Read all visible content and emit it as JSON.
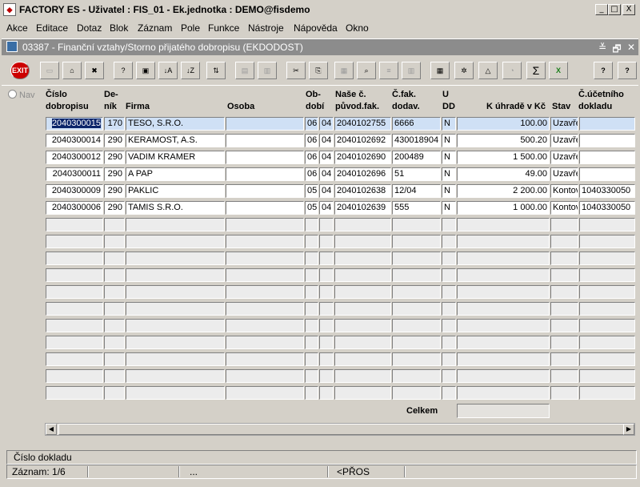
{
  "window": {
    "title": "FACTORY ES - Uživatel : FIS_01 - Ek.jednotka : DEMO@fisdemo",
    "controls": [
      "_",
      "□",
      "X"
    ]
  },
  "menu": [
    "Akce",
    "Editace",
    "Dotaz",
    "Blok",
    "Záznam",
    "Pole",
    "Funkce",
    "Nástroje",
    "Nápověda",
    "Okno"
  ],
  "form": {
    "title": "03387 - Finanční vztahy/Storno přijatého dobropisu (EKDODOST)",
    "controls": [
      "≚",
      "🗗",
      "✕"
    ]
  },
  "toolbar": {
    "exit_label": "EXIT",
    "sigma_label": "Σ",
    "help_label": "?",
    "help2_label": "?"
  },
  "nav_label": "Nav",
  "columns": {
    "cislo": [
      "Číslo",
      "dobropisu"
    ],
    "denik": [
      "De-",
      "ník"
    ],
    "firma": "Firma",
    "osoba": "Osoba",
    "obdobi": [
      "Ob-",
      "dobí"
    ],
    "nase": [
      "Naše č.",
      "původ.fak."
    ],
    "cfak": [
      "Č.fak.",
      "dodav."
    ],
    "udd": [
      "U",
      "DD"
    ],
    "kuhrade": "K úhradě v Kč",
    "stav": "Stav",
    "cucet": [
      "Č.účetního",
      "dokladu"
    ]
  },
  "rows": [
    {
      "cislo": "2040300015",
      "denik": "170",
      "firma": "TESO, S.R.O.",
      "osoba": "",
      "ob1": "06",
      "ob2": "04",
      "nase": "2040102755",
      "cfak": "6666",
      "udd": "N",
      "kuhrade": "100.00",
      "stav": "Uzavře",
      "cucet": ""
    },
    {
      "cislo": "2040300014",
      "denik": "290",
      "firma": "KERAMOST, A.S.",
      "osoba": "",
      "ob1": "06",
      "ob2": "04",
      "nase": "2040102692",
      "cfak": "430018904",
      "udd": "N",
      "kuhrade": "500.20",
      "stav": "Uzavře",
      "cucet": ""
    },
    {
      "cislo": "2040300012",
      "denik": "290",
      "firma": "VADIM KRAMER",
      "osoba": "",
      "ob1": "06",
      "ob2": "04",
      "nase": "2040102690",
      "cfak": "200489",
      "udd": "N",
      "kuhrade": "1 500.00",
      "stav": "Uzavře",
      "cucet": ""
    },
    {
      "cislo": "2040300011",
      "denik": "290",
      "firma": "A PAP",
      "osoba": "",
      "ob1": "06",
      "ob2": "04",
      "nase": "2040102696",
      "cfak": "51",
      "udd": "N",
      "kuhrade": "49.00",
      "stav": "Uzavře",
      "cucet": ""
    },
    {
      "cislo": "2040300009",
      "denik": "290",
      "firma": "PAKLIC",
      "osoba": "",
      "ob1": "05",
      "ob2": "04",
      "nase": "2040102638",
      "cfak": "12/04",
      "udd": "N",
      "kuhrade": "2 200.00",
      "stav": "Kontov",
      "cucet": "1040330050"
    },
    {
      "cislo": "2040300006",
      "denik": "290",
      "firma": "TAMIS S.R.O.",
      "osoba": "",
      "ob1": "05",
      "ob2": "04",
      "nase": "2040102639",
      "cfak": "555",
      "udd": "N",
      "kuhrade": "1 000.00",
      "stav": "Kontov",
      "cucet": "1040330050"
    }
  ],
  "empty_rows": 11,
  "total_label": "Celkem",
  "total_value": "",
  "hint": "Číslo dokladu",
  "status": {
    "record": "Záznam: 1/6",
    "dots": "...",
    "mode": "<PŘOS"
  }
}
